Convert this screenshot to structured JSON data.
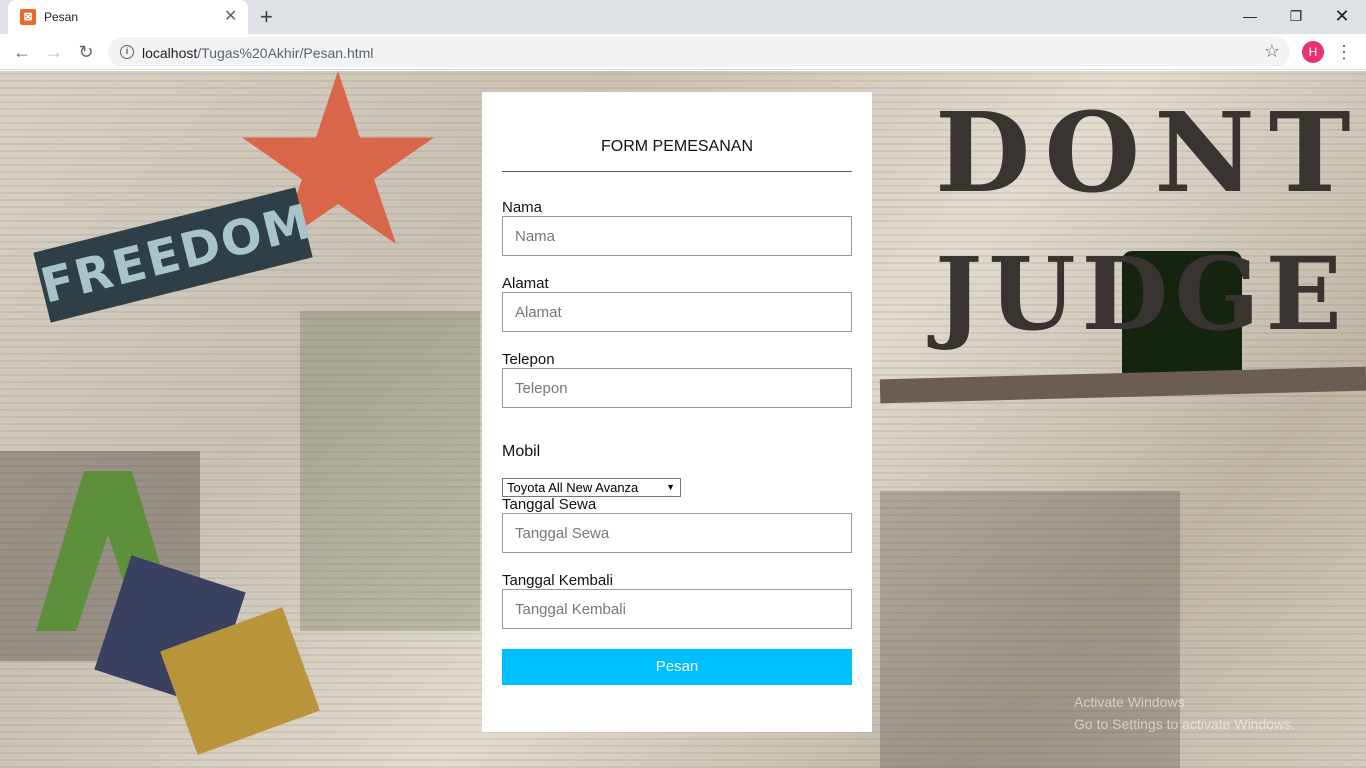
{
  "browser": {
    "tab_title": "Pesan",
    "tab_icon": "xampp-icon",
    "url_host": "localhost",
    "url_path": "/Tugas%20Akhir/Pesan.html",
    "avatar_letter": "H"
  },
  "background": {
    "freedom_text": "FREEDOM",
    "dont_text": "DONT",
    "judge_text": "JUDGE",
    "watermark_line1": "Activate Windows",
    "watermark_line2": "Go to Settings to activate Windows."
  },
  "form": {
    "title": "FORM PEMESANAN",
    "nama_label": "Nama",
    "nama_placeholder": "Nama",
    "alamat_label": "Alamat",
    "alamat_placeholder": "Alamat",
    "telepon_label": "Telepon",
    "telepon_placeholder": "Telepon",
    "mobil_label": "Mobil",
    "mobil_selected": "Toyota All New Avanza",
    "tanggal_sewa_label": "Tanggal Sewa",
    "tanggal_sewa_placeholder": "Tanggal Sewa",
    "tanggal_kembali_label": "Tanggal Kembali",
    "tanggal_kembali_placeholder": "Tanggal Kembali",
    "submit_label": "Pesan"
  },
  "colors": {
    "submit_button": "#00bfff",
    "card_background": "#ffffff",
    "avatar": "#e8336d"
  }
}
